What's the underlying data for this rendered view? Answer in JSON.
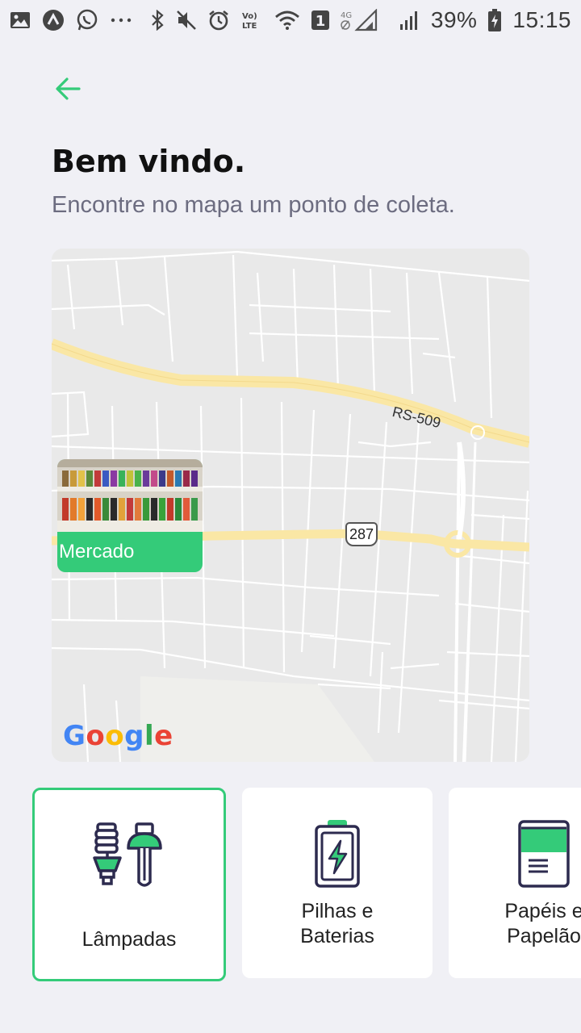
{
  "status_bar": {
    "battery": "39%",
    "time": "15:15",
    "sim": "1",
    "network": "4G"
  },
  "header": {
    "back_icon": "arrow-left-icon",
    "title": "Bem vindo.",
    "subtitle": "Encontre no mapa um ponto de coleta."
  },
  "map": {
    "marker_label": "Mercado",
    "road_label": "RS-509",
    "route_badge": "287",
    "attribution": "Google"
  },
  "colors": {
    "accent": "#34cb79",
    "title": "#111111",
    "subtitle": "#6c6c80",
    "background": "#f0f0f5"
  },
  "items": [
    {
      "label": "Lâmpadas",
      "icon": "lamp-icon",
      "selected": true
    },
    {
      "label": "Pilhas e\nBaterias",
      "icon": "battery-icon",
      "selected": false
    },
    {
      "label": "Papéis e\nPapelão",
      "icon": "paper-icon",
      "selected": false
    }
  ]
}
